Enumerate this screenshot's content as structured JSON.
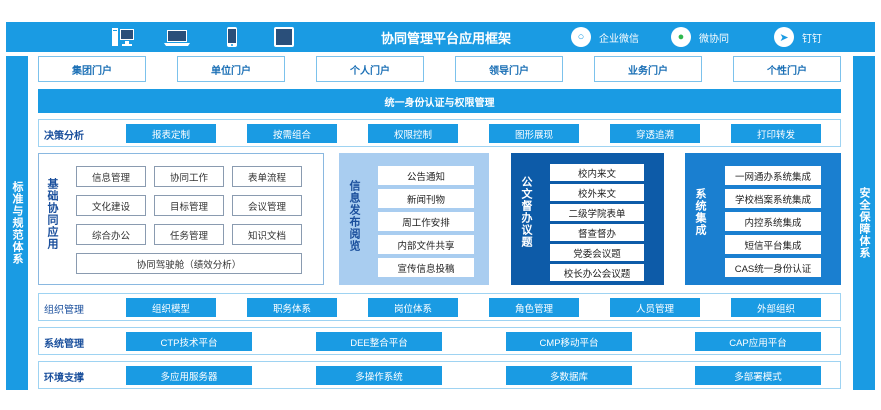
{
  "header": {
    "title": "协同管理平台应用框架",
    "apps": [
      {
        "label": "企业微信",
        "icon": "wecom-icon"
      },
      {
        "label": "微协同",
        "icon": "wechat-icon"
      },
      {
        "label": "钉钉",
        "icon": "dingtalk-icon"
      }
    ],
    "devices": [
      "desktop-icon",
      "laptop-icon",
      "phone-icon",
      "tablet-icon"
    ]
  },
  "left_side": "标准与规范体系",
  "right_side": "安全保障体系",
  "portals": [
    "集团门户",
    "单位门户",
    "个人门户",
    "领导门户",
    "业务门户",
    "个性门户"
  ],
  "identity_bar": "统一身份认证与权限管理",
  "decision": {
    "label": "决策分析",
    "items": [
      "报表定制",
      "按需组合",
      "权限控制",
      "图形展现",
      "穿透追溯",
      "打印转发"
    ]
  },
  "basic_apps": {
    "label": "基础协同应用",
    "items": [
      "信息管理",
      "协同工作",
      "表单流程",
      "文化建设",
      "目标管理",
      "会议管理",
      "综合办公",
      "任务管理",
      "知识文档"
    ],
    "wide": "协同驾驶舱（绩效分析）"
  },
  "info_publish": {
    "label": "信息发布阅览",
    "items": [
      "公告通知",
      "新闻刊物",
      "周工作安排",
      "内部文件共享",
      "宣传信息投稿"
    ]
  },
  "official_doc": {
    "label": "公文督办议题",
    "items": [
      "校内来文",
      "校外来文",
      "二级学院表单",
      "督查督办",
      "党委会议题",
      "校长办公会议题"
    ]
  },
  "system_integration": {
    "label": "系统集成",
    "items": [
      "一网通办系统集成",
      "学校档案系统集成",
      "内控系统集成",
      "短信平台集成",
      "CAS统一身份认证"
    ]
  },
  "org": {
    "label": "组织管理",
    "items": [
      "组织模型",
      "职务体系",
      "岗位体系",
      "角色管理",
      "人员管理",
      "外部组织"
    ]
  },
  "sysmgmt": {
    "label": "系统管理",
    "items": [
      "CTP技术平台",
      "DEE整合平台",
      "CMP移动平台",
      "CAP应用平台"
    ]
  },
  "env": {
    "label": "环境支撑",
    "items": [
      "多应用服务器",
      "多操作系统",
      "多数据库",
      "多部署模式"
    ]
  },
  "colors": {
    "primary": "#1a9be3",
    "info_panel": "#a9cdf0",
    "doc_panel": "#0d5ba8",
    "integration_panel": "#1a7fd0",
    "label_text": "#1a4f9c"
  }
}
